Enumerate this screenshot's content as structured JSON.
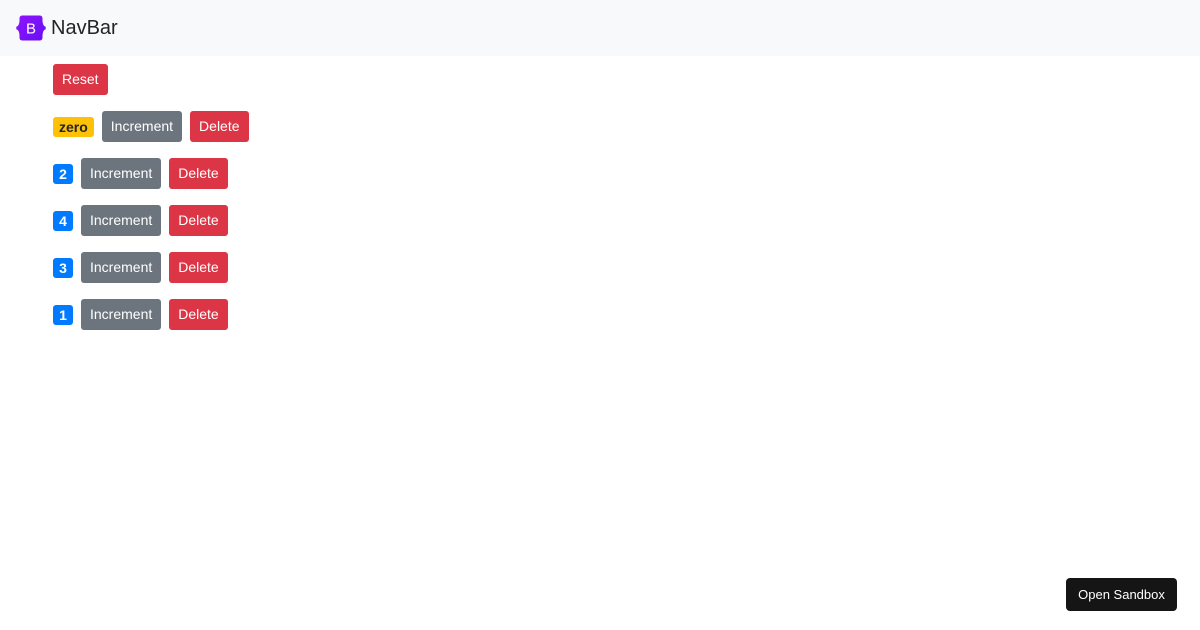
{
  "navbar": {
    "brand_text": "NavBar",
    "logo_letter": "B",
    "logo_color": "#7952b3"
  },
  "controls": {
    "reset_label": "Reset"
  },
  "counters": [
    {
      "value": "zero",
      "badge_color": "#ffc107",
      "increment_label": "Increment",
      "delete_label": "Delete"
    },
    {
      "value": "2",
      "badge_color": "#007bff",
      "increment_label": "Increment",
      "delete_label": "Delete"
    },
    {
      "value": "4",
      "badge_color": "#007bff",
      "increment_label": "Increment",
      "delete_label": "Delete"
    },
    {
      "value": "3",
      "badge_color": "#007bff",
      "increment_label": "Increment",
      "delete_label": "Delete"
    },
    {
      "value": "1",
      "badge_color": "#007bff",
      "increment_label": "Increment",
      "delete_label": "Delete"
    }
  ],
  "sandbox": {
    "button_label": "Open Sandbox"
  },
  "colors": {
    "danger": "#dc3545",
    "secondary": "#6c757d",
    "primary": "#007bff",
    "warning": "#ffc107",
    "navbar_bg": "#f8f9fa"
  }
}
